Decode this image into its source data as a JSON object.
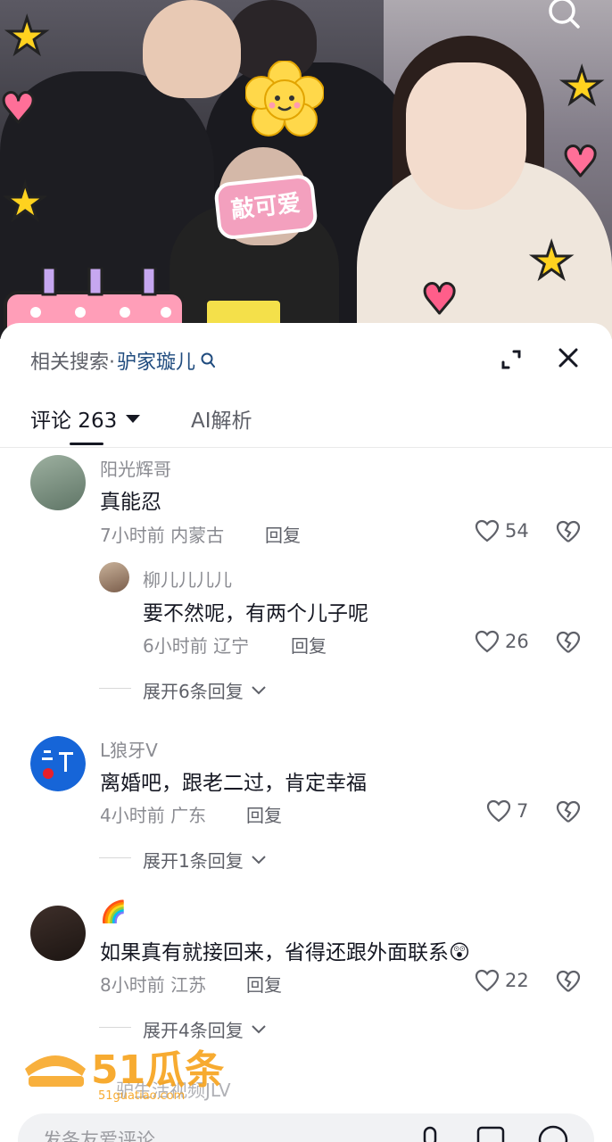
{
  "related_search": {
    "prefix": "相关搜索·",
    "keyword": "驴家璇儿"
  },
  "photo": {
    "sticker_text": "敲可爱"
  },
  "tabs": {
    "comments_label": "评论 263",
    "ai_label": "AI解析"
  },
  "comments": [
    {
      "username": "阳光辉哥",
      "text": "真能忍",
      "time_location": "7小时前 内蒙古",
      "reply_label": "回复",
      "likes": "54",
      "replies": [
        {
          "username": "柳儿儿儿儿",
          "text": "要不然呢，有两个儿子呢",
          "time_location": "6小时前 辽宁",
          "reply_label": "回复",
          "likes": "26"
        }
      ],
      "expand_label": "展开6条回复"
    },
    {
      "username": "L狼牙V",
      "text": "离婚吧，跟老二过，肯定幸福",
      "time_location": "4小时前 广东",
      "reply_label": "回复",
      "likes": "7",
      "expand_label": "展开1条回复"
    },
    {
      "username": "🌈",
      "text": "如果真有就接回来，省得还跟外面联系😲",
      "time_location": "8小时前 江苏",
      "reply_label": "回复",
      "likes": "22",
      "expand_label": "展开4条回复"
    },
    {
      "username": "驴生活视频JLV"
    }
  ],
  "watermark": {
    "brand": "51瓜条",
    "url": "51guatiao.com"
  },
  "input": {
    "placeholder": "发条友爱评论..."
  },
  "colors": {
    "link_blue": "#1f4b7e",
    "text_primary": "#161823",
    "text_secondary": "#8a8b91",
    "watermark_orange": "#f7a21b"
  }
}
